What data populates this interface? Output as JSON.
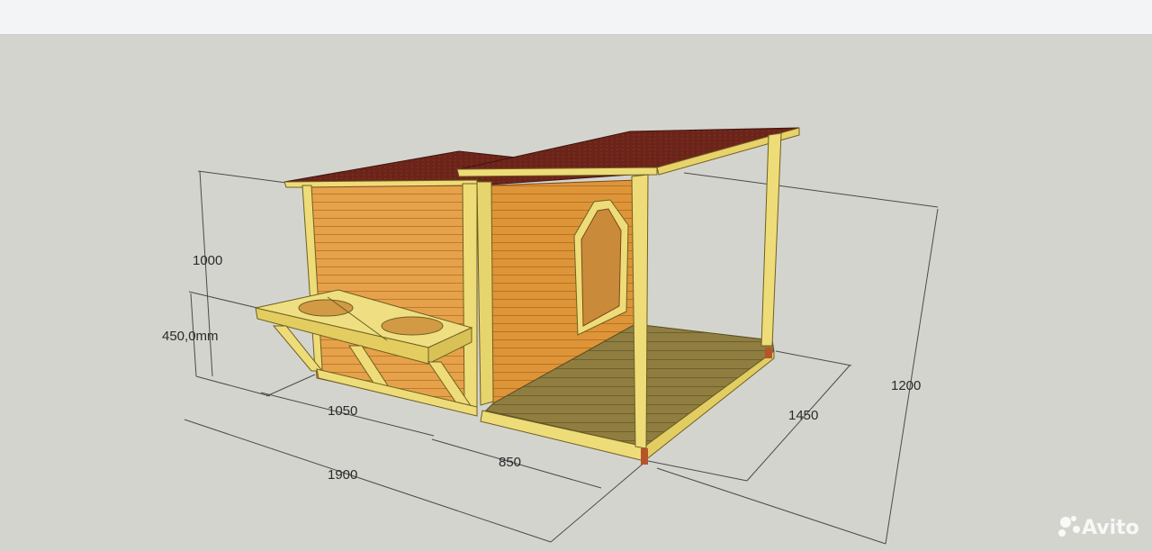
{
  "dimensions": {
    "height_house": "1000",
    "height_shelf": "450,0mm",
    "length_house": "1050",
    "length_total": "1900",
    "length_porch": "850",
    "depth_porch": "1450",
    "height_total": "1200"
  },
  "watermark": {
    "text": "Avito",
    "logo": "avito-dots-logo"
  },
  "colors": {
    "background": "#d4d4cf",
    "wall": "#e19a3e",
    "roof": "#6a2418",
    "frame": "#eedc78",
    "deck": "#8a7a3e"
  }
}
